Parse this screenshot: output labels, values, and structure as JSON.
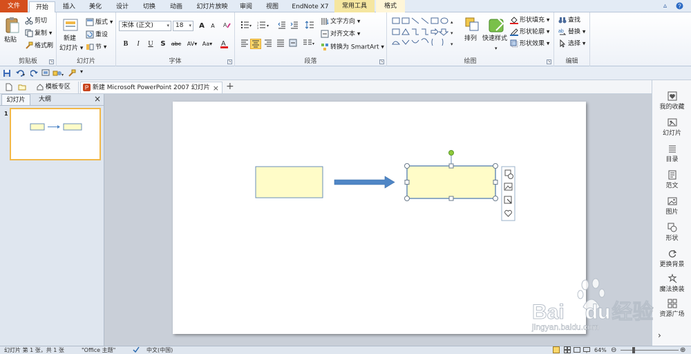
{
  "ribbon_tabs": [
    {
      "label": "文件"
    },
    {
      "label": "开始"
    },
    {
      "label": "插入"
    },
    {
      "label": "美化"
    },
    {
      "label": "设计"
    },
    {
      "label": "切换"
    },
    {
      "label": "动画"
    },
    {
      "label": "幻灯片放映"
    },
    {
      "label": "审阅"
    },
    {
      "label": "视图"
    },
    {
      "label": "EndNote X7"
    },
    {
      "label": "常用工具"
    },
    {
      "label": "格式"
    }
  ],
  "clipboard": {
    "paste": "粘贴",
    "cut": "剪切",
    "copy": "复制",
    "format_painter": "格式刷",
    "label": "剪贴板"
  },
  "slides_group": {
    "new_slide": "新建",
    "new_slide2": "幻灯片",
    "layout": "版式",
    "reset": "重设",
    "section": "节",
    "label": "幻灯片"
  },
  "font_group": {
    "font_name": "宋体 (正文)",
    "font_size": "18",
    "bold": "B",
    "italic": "I",
    "underline": "U",
    "strike": "S",
    "shadow": "abc",
    "spacing": "AV",
    "case": "Aa",
    "grow": "A",
    "shrink": "A",
    "label": "字体"
  },
  "paragraph_group": {
    "text_direction": "文字方向",
    "align_text": "对齐文本",
    "smartart": "转换为 SmartArt",
    "label": "段落"
  },
  "drawing_group": {
    "arrange": "排列",
    "quick_styles": "快速样式",
    "shape_fill": "形状填充",
    "shape_outline": "形状轮廓",
    "shape_effects": "形状效果",
    "label": "绘图"
  },
  "editing_group": {
    "find": "查找",
    "replace": "替换",
    "select": "选择",
    "label": "编辑"
  },
  "doc_tabs": {
    "template": "模板专区",
    "document": "新建 Microsoft PowerPoint 2007 幻灯片"
  },
  "left_pane": {
    "tab_slides": "幻灯片",
    "tab_outline": "大纲",
    "slide_number": "1"
  },
  "sidebar": [
    {
      "label": "我的收藏",
      "icon": "heart-box-icon"
    },
    {
      "label": "幻灯片",
      "icon": "slide-icon"
    },
    {
      "label": "目录",
      "icon": "list-icon"
    },
    {
      "label": "范文",
      "icon": "document-icon"
    },
    {
      "label": "图片",
      "icon": "picture-icon"
    },
    {
      "label": "形状",
      "icon": "shapes-icon"
    },
    {
      "label": "更换背景",
      "icon": "refresh-icon"
    },
    {
      "label": "魔法换装",
      "icon": "magic-icon"
    },
    {
      "label": "资源广场",
      "icon": "grid-icon"
    }
  ],
  "status": {
    "slide_info": "幻灯片 第 1 张，共 1 张",
    "theme": "\"Office 主题\"",
    "language": "中文(中国)",
    "zoom": "64%"
  },
  "watermark": {
    "brand": "Bai",
    "brand2": "du",
    "brand3": "经验",
    "url": "jingyan.baidu.com"
  },
  "colors": {
    "file_tab": "#d54f1d",
    "shape_fill": "#fffcc8",
    "shape_stroke": "#6a8fb8",
    "arrow": "#4f86c6",
    "selection_handle": "#8fc93a"
  }
}
